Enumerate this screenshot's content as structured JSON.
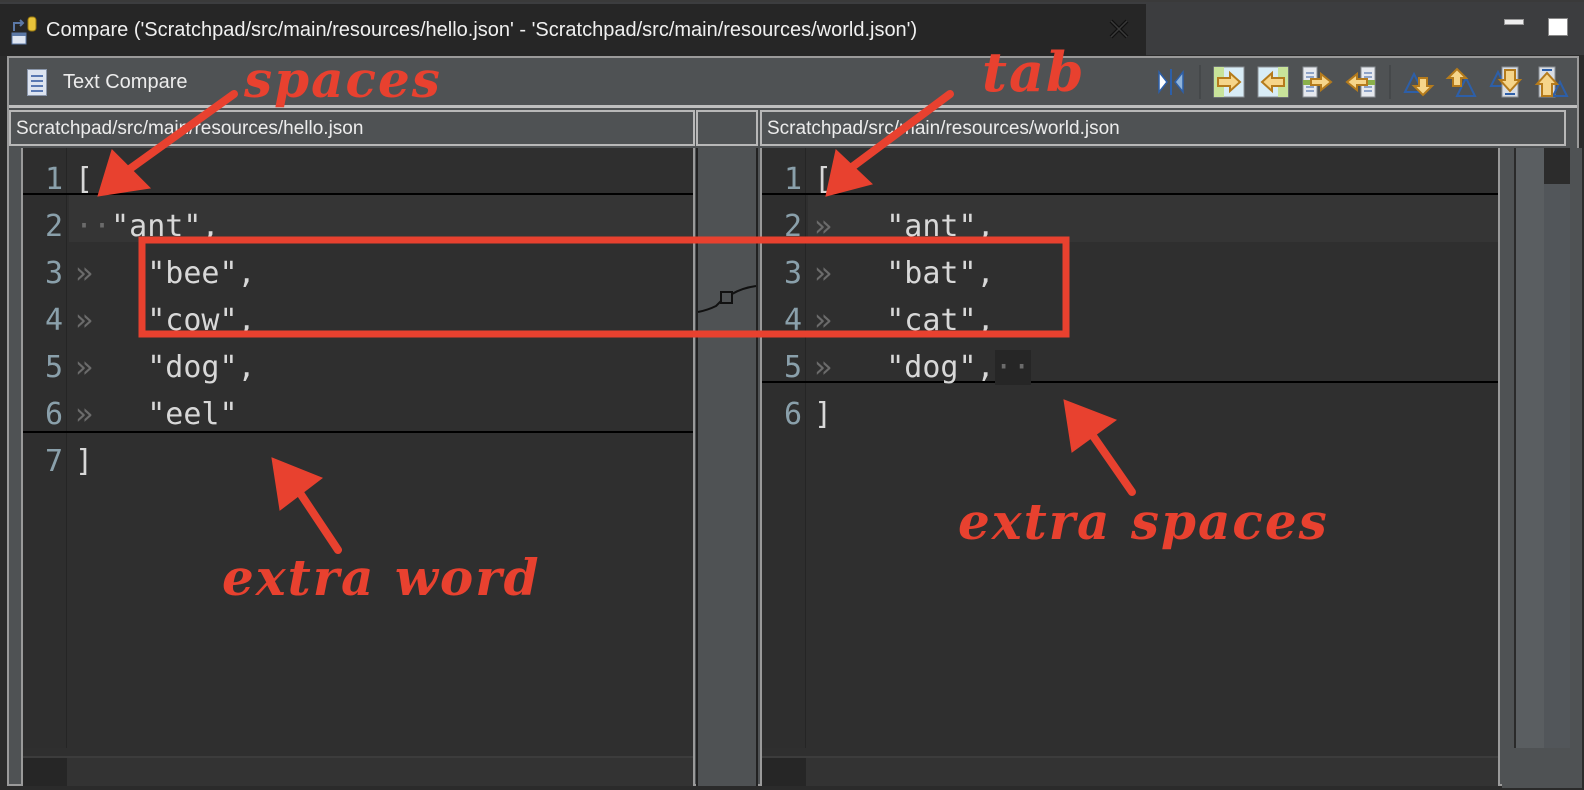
{
  "window": {
    "tab_title": "Compare ('Scratchpad/src/main/resources/hello.json' - 'Scratchpad/src/main/resources/world.json')",
    "tab_icon": "compare-icon",
    "close_icon": "close-icon",
    "minimize_icon": "minimize-icon",
    "maximize_icon": "maximize-icon"
  },
  "toolbar": {
    "label": "Text Compare",
    "icon": "document-icon",
    "buttons": [
      {
        "name": "ignore-whitespace-button",
        "icon": "ignore-whitespace-icon"
      },
      {
        "name": "copy-all-left-to-right-button",
        "icon": "copy-all-right-icon"
      },
      {
        "name": "copy-all-right-to-left-button",
        "icon": "copy-all-left-icon"
      },
      {
        "name": "copy-current-left-to-right-button",
        "icon": "copy-change-right-icon"
      },
      {
        "name": "copy-current-right-to-left-button",
        "icon": "copy-change-left-icon"
      },
      {
        "name": "next-difference-button",
        "icon": "next-difference-icon"
      },
      {
        "name": "previous-difference-button",
        "icon": "previous-difference-icon"
      },
      {
        "name": "next-change-button",
        "icon": "next-change-icon"
      },
      {
        "name": "previous-change-button",
        "icon": "previous-change-icon"
      }
    ]
  },
  "left": {
    "header": "Scratchpad/src/main/resources/hello.json",
    "lines": [
      {
        "n": "1",
        "ws": "",
        "text": "["
      },
      {
        "n": "2",
        "ws": "··",
        "text": "\"ant\","
      },
      {
        "n": "3",
        "ws": "»   ",
        "text": "\"bee\","
      },
      {
        "n": "4",
        "ws": "»   ",
        "text": "\"cow\","
      },
      {
        "n": "5",
        "ws": "»   ",
        "text": "\"dog\","
      },
      {
        "n": "6",
        "ws": "»   ",
        "text": "\"eel\""
      },
      {
        "n": "7",
        "ws": "",
        "text": "]"
      }
    ]
  },
  "right": {
    "header": "Scratchpad/src/main/resources/world.json",
    "lines": [
      {
        "n": "1",
        "ws": "",
        "text": "["
      },
      {
        "n": "2",
        "ws": "»   ",
        "text": "\"ant\","
      },
      {
        "n": "3",
        "ws": "»   ",
        "text": "\"bat\","
      },
      {
        "n": "4",
        "ws": "»   ",
        "text": "\"cat\","
      },
      {
        "n": "5",
        "ws": "»   ",
        "text": "\"dog\",",
        "trail": "··"
      },
      {
        "n": "6",
        "ws": "",
        "text": "]"
      }
    ]
  },
  "annotations": {
    "spaces": "spaces",
    "tab": "tab",
    "extra_word": "extra word",
    "extra_spaces": "extra spaces",
    "color": "#e8412f"
  }
}
